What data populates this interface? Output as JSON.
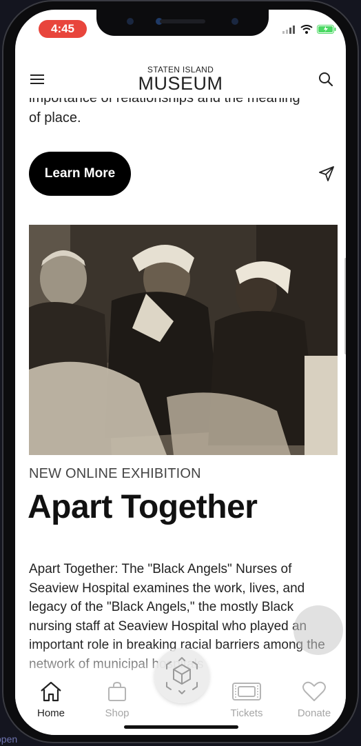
{
  "status_bar": {
    "time": "4:45"
  },
  "header": {
    "logo_top": "STATEN ISLAND",
    "logo_main": "MUSEUM"
  },
  "intro": {
    "partial_line": "importance of relationships and the meaning",
    "end_line": "of place."
  },
  "cta": {
    "learn_more": "Learn More"
  },
  "exhibition": {
    "kicker": "NEW ONLINE EXHIBITION",
    "title": "Apart Together",
    "description": "Apart Together: The \"Black Angels\" Nurses of Seaview Hospital examines the work, lives, and legacy of the \"Black Angels,\" the mostly Black nursing staff at Seaview Hospital who played an important role in breaking racial barriers among the network of municipal hospitals"
  },
  "tabbar": {
    "tabs": [
      {
        "label": "Home",
        "icon": "home-icon",
        "active": true
      },
      {
        "label": "Shop",
        "icon": "shopping-bag-icon",
        "active": false
      },
      {
        "label": "Tickets",
        "icon": "ticket-icon",
        "active": false
      },
      {
        "label": "Donate",
        "icon": "heart-icon",
        "active": false
      }
    ]
  },
  "colors": {
    "time_pill": "#e8453c",
    "button": "#000000",
    "text": "#222222",
    "inactive_tab": "#a6a6a6"
  },
  "edge_text": "open"
}
